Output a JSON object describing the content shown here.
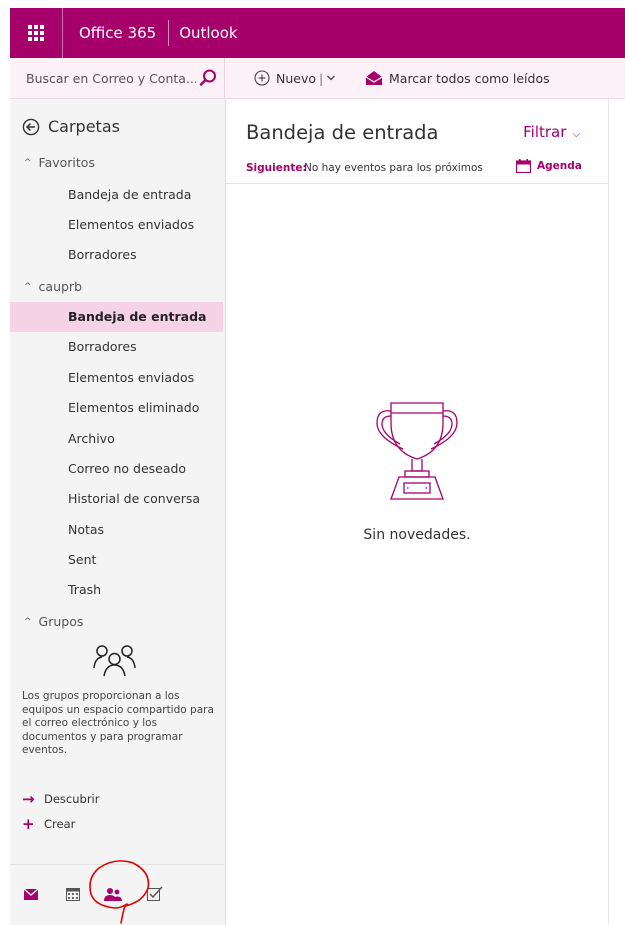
{
  "topbar": {
    "brand": "Office 365",
    "app": "Outlook"
  },
  "search": {
    "placeholder": "Buscar en Correo y Conta..."
  },
  "commands": {
    "new_label": "Nuevo",
    "markread_label": "Marcar todos como leídos"
  },
  "nav": {
    "header": "Carpetas",
    "favorites": {
      "label": "Favoritos",
      "items": [
        "Bandeja de entrada",
        "Elementos enviados",
        "Borradores"
      ]
    },
    "account": {
      "label": "cauprb",
      "items": [
        "Bandeja de entrada",
        "Borradores",
        "Elementos enviados",
        "Elementos eliminado",
        "Archivo",
        "Correo no deseado",
        "Historial de conversa",
        "Notas",
        "Sent",
        "Trash"
      ],
      "selected": "Bandeja de entrada"
    },
    "groups": {
      "label": "Grupos",
      "description": "Los grupos proporcionan a los equipos un espacio compartido para el correo electrónico y los documentos y para programar eventos.",
      "discover": "Descubrir",
      "create": "Crear"
    }
  },
  "bottom_nav": {
    "icons": [
      "mail-icon",
      "calendar-icon",
      "people-icon",
      "tasks-icon"
    ]
  },
  "list": {
    "title": "Bandeja de entrada",
    "filter": "Filtrar",
    "next_label": "Siguiente:",
    "next_text": "No hay eventos para los próximos",
    "agenda": "Agenda",
    "empty": "Sin novedades."
  },
  "colors": {
    "accent": "#a6006a",
    "selected_bg": "#f5d2e6",
    "annotation": "#e00000"
  }
}
